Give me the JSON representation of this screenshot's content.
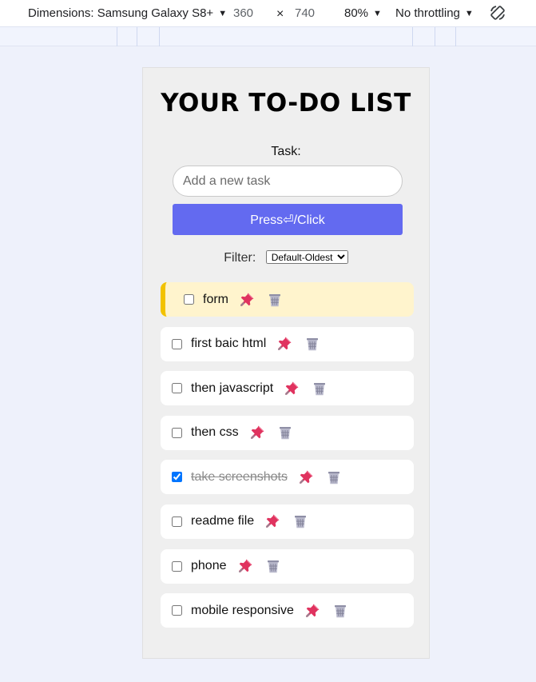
{
  "devtools": {
    "device_label": "Dimensions: Samsung Galaxy S8+",
    "width": "360",
    "times": "×",
    "height": "740",
    "zoom": "80%",
    "throttling": "No throttling"
  },
  "app": {
    "title": "YOUR TO-DO LIST",
    "task_label": "Task:",
    "input_placeholder": "Add a new task",
    "input_value": "",
    "add_button_label": "Press⏎/Click",
    "filter_label": "Filter:",
    "filter_selected": "Default-Oldest",
    "colors": {
      "button": "#636af0",
      "pinned_bg": "#fff4cd",
      "pinned_bar": "#f2c200"
    },
    "tasks": [
      {
        "text": "form",
        "checked": false,
        "pinned": true
      },
      {
        "text": "first baic html",
        "checked": false,
        "pinned": false
      },
      {
        "text": "then javascript",
        "checked": false,
        "pinned": false
      },
      {
        "text": "then css",
        "checked": false,
        "pinned": false
      },
      {
        "text": "take screenshots",
        "checked": true,
        "pinned": false
      },
      {
        "text": "readme file",
        "checked": false,
        "pinned": false
      },
      {
        "text": "phone",
        "checked": false,
        "pinned": false
      },
      {
        "text": "mobile responsive",
        "checked": false,
        "pinned": false
      }
    ],
    "icons": {
      "pin": "pushpin-icon",
      "delete": "wastebasket-icon"
    }
  }
}
